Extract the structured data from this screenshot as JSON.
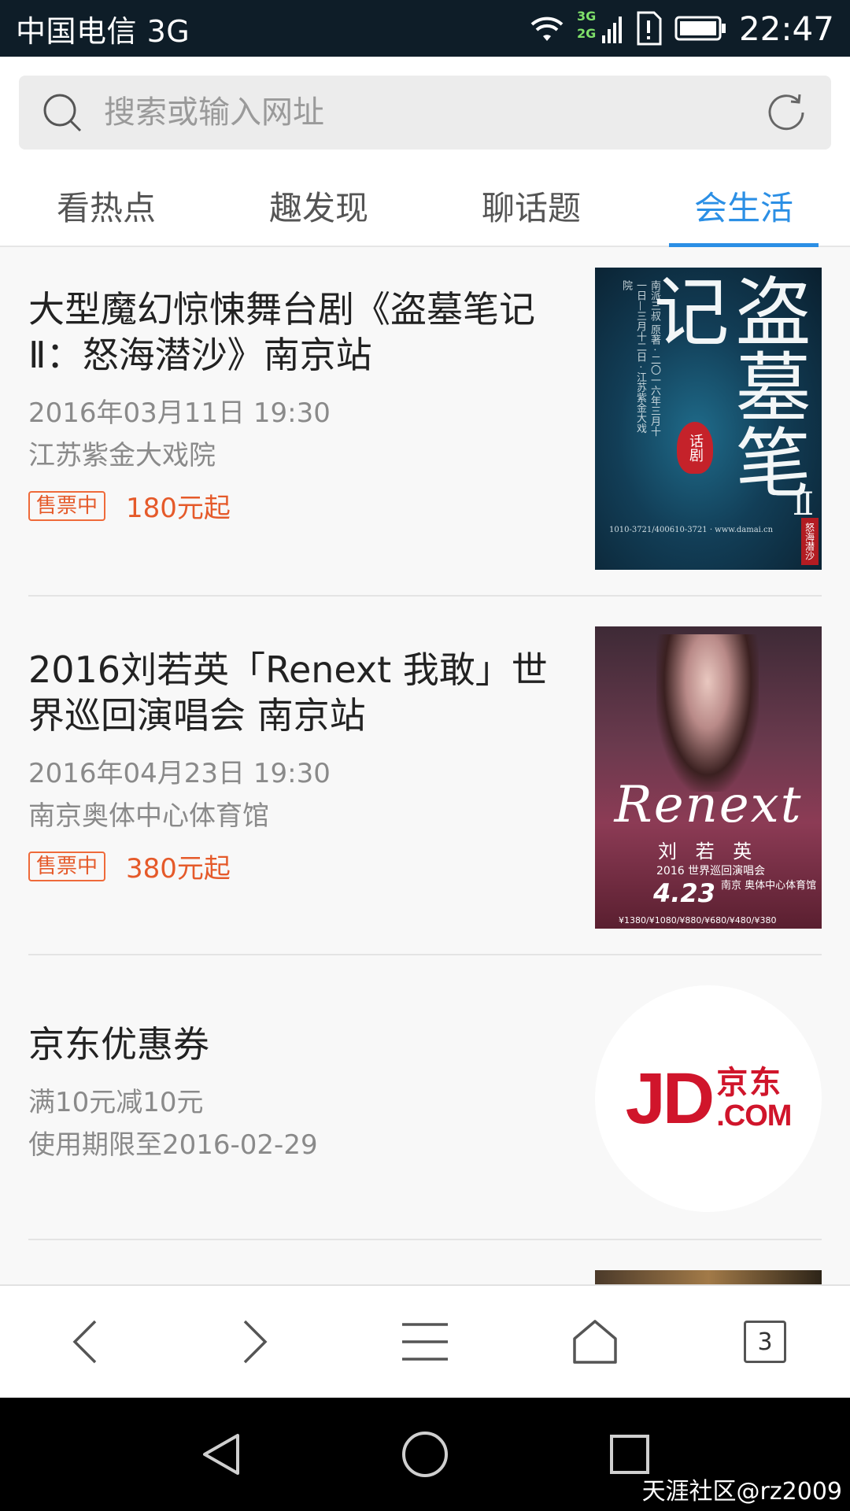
{
  "status_bar": {
    "carrier": "中国电信 3G",
    "network_badge_top": "3G",
    "network_badge_bottom": "2G",
    "time": "22:47"
  },
  "search": {
    "placeholder": "搜索或输入网址",
    "icon": "search-icon",
    "refresh_icon": "refresh-icon"
  },
  "tabs": [
    {
      "label": "看热点",
      "active": false
    },
    {
      "label": "趣发现",
      "active": false
    },
    {
      "label": "聊话题",
      "active": false
    },
    {
      "label": "会生活",
      "active": true
    }
  ],
  "feed": [
    {
      "title": "大型魔幻惊悚舞台剧《盗墓笔记Ⅱ：怒海潜沙》南京站",
      "date": "2016年03月11日 19:30",
      "venue": "江苏紫金大戏院",
      "badge": "售票中",
      "price": "180元起",
      "poster": {
        "big_text": "盗墓笔记",
        "roman": "Ⅱ",
        "seal": "话剧",
        "side_tag": "怒海潜沙"
      }
    },
    {
      "title": "2016刘若英「Renext 我敢」世界巡回演唱会 南京站",
      "date": "2016年04月23日 19:30",
      "venue": "南京奥体中心体育馆",
      "badge": "售票中",
      "price": "380元起",
      "poster": {
        "script": "Renext",
        "name": "刘 若 英",
        "tour": "2016 世界巡回演唱会",
        "date": "4.23",
        "venue": "南京 奥体中心体育馆",
        "prices": "¥1380/¥1080/¥880/¥680/¥480/¥380"
      }
    },
    {
      "title": "京东优惠券",
      "desc": "满10元减10元",
      "expiry": "使用期限至2016-02-29",
      "logo": {
        "jd": "JD",
        "cn": "京东",
        "com": ".COM"
      }
    }
  ],
  "toolbar": {
    "back_icon": "back-icon",
    "forward_icon": "forward-icon",
    "menu_icon": "menu-icon",
    "home_icon": "home-icon",
    "tab_count": "3"
  },
  "watermark": "天涯社区@rz2009",
  "colors": {
    "accent": "#2b8fe5",
    "price": "#e55a2a",
    "status_bar": "#0e1d28",
    "jd_red": "#d0152b"
  }
}
